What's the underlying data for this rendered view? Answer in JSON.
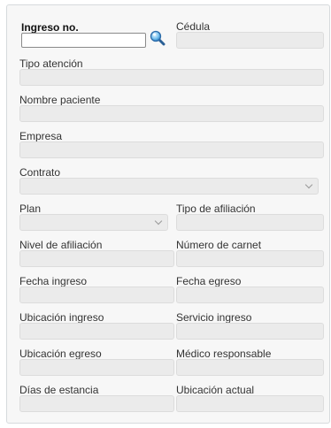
{
  "form": {
    "ingreso_label": "Ingreso no.",
    "ingreso_value": "",
    "cedula_label": "Cédula",
    "tipo_atencion_label": "Tipo atención",
    "nombre_paciente_label": "Nombre paciente",
    "empresa_label": "Empresa",
    "contrato_label": "Contrato",
    "plan_label": "Plan",
    "tipo_afiliacion_label": "Tipo de afiliación",
    "nivel_afiliacion_label": "Nivel de afiliación",
    "numero_carnet_label": "Número de carnet",
    "fecha_ingreso_label": "Fecha ingreso",
    "fecha_egreso_label": "Fecha egreso",
    "ubicacion_ingreso_label": "Ubicación ingreso",
    "servicio_ingreso_label": "Servicio ingreso",
    "ubicacion_egreso_label": "Ubicación egreso",
    "medico_responsable_label": "Médico responsable",
    "dias_estancia_label": "Días de estancia",
    "ubicacion_actual_label": "Ubicación actual"
  },
  "icons": {
    "search": "search-icon",
    "dropdown": "chevron-down-icon"
  },
  "colors": {
    "panel_bg": "#f7f7f7",
    "field_disabled_bg": "#ebebeb",
    "field_border": "#dcdcdc"
  }
}
